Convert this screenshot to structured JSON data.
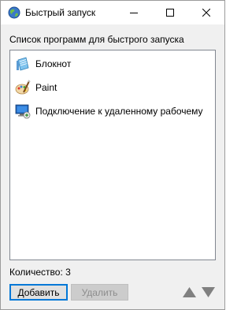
{
  "window": {
    "title": "Быстрый запуск",
    "icon": "globe-icon",
    "controls": {
      "minimize": "minimize-icon",
      "maximize": "maximize-icon",
      "close": "close-icon"
    }
  },
  "list": {
    "caption": "Список программ для быстрого запуска",
    "items": [
      {
        "label": "Блокнот",
        "icon": "notepad-icon"
      },
      {
        "label": "Paint",
        "icon": "paint-icon"
      },
      {
        "label": "Подключение к удаленному рабочему",
        "icon": "remote-desktop-icon"
      }
    ]
  },
  "status": {
    "count_text": "Количество: 3"
  },
  "buttons": {
    "add": "Добавить",
    "delete": "Удалить",
    "move_up": "move-up-icon",
    "move_down": "move-down-icon"
  },
  "colors": {
    "accent": "#0078d7",
    "disabled_text": "#8d8d8d",
    "arrow": "#808080"
  }
}
